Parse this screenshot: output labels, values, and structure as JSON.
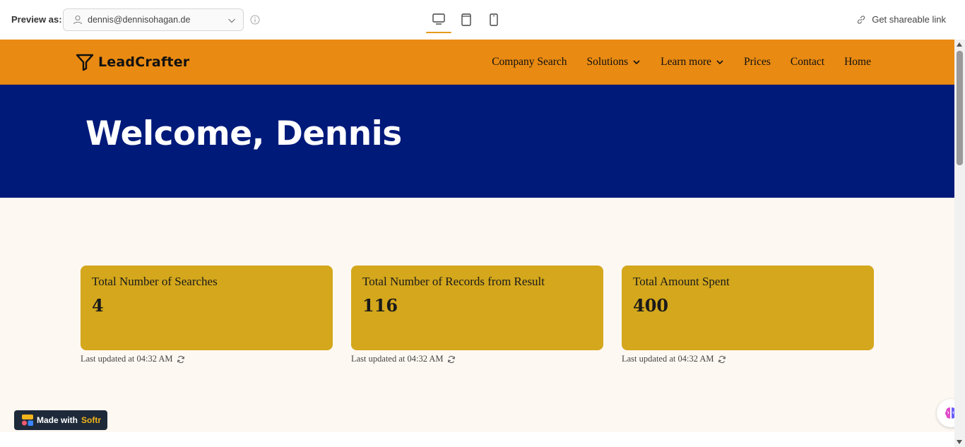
{
  "preview": {
    "label": "Preview as:",
    "user_value": "dennis@dennisohagan.de",
    "share_label": "Get shareable link"
  },
  "nav": {
    "brand": "LeadCrafter",
    "items": [
      {
        "label": "Company Search"
      },
      {
        "label": "Solutions"
      },
      {
        "label": "Learn more"
      },
      {
        "label": "Prices"
      },
      {
        "label": "Contact"
      },
      {
        "label": "Home"
      }
    ]
  },
  "hero": {
    "title": "Welcome, Dennis"
  },
  "stats": [
    {
      "title": "Total Number of Searches",
      "value": "4",
      "updated": "Last updated at 04:32 AM"
    },
    {
      "title": "Total Number of Records from Result",
      "value": "116",
      "updated": "Last updated at 04:32 AM"
    },
    {
      "title": "Total Amount Spent",
      "value": "400",
      "updated": "Last updated at 04:32 AM"
    }
  ],
  "badge": {
    "prefix": "Made with",
    "brand": "Softr"
  },
  "colors": {
    "nav_bg": "#e98a12",
    "hero_bg": "#001a7a",
    "card_bg": "#d4a71c",
    "page_bg": "#fdf8f2"
  }
}
